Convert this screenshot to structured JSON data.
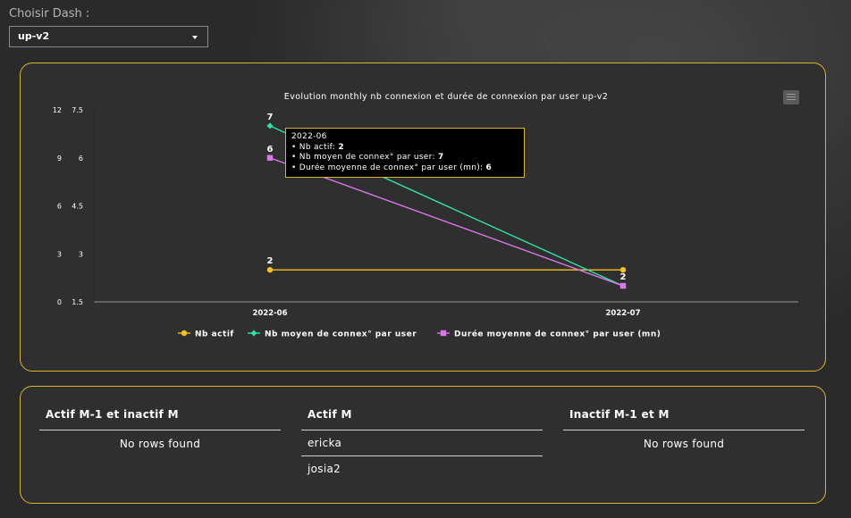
{
  "selector": {
    "label": "Choisir Dash :",
    "value": "up-v2",
    "icon": "chevron-down-icon"
  },
  "chart_menu_icon": "hamburger-menu-icon",
  "chart_data": {
    "type": "line",
    "title": "Evolution monthly nb connexion et durée de connexion par user up-v2",
    "categories": [
      "2022-06",
      "2022-07"
    ],
    "axes": [
      {
        "ticks": [
          "0",
          "3",
          "6",
          "9",
          "12"
        ],
        "range": [
          0,
          12
        ]
      },
      {
        "ticks": [
          "1.5",
          "3",
          "4.5",
          "6",
          "7.5"
        ],
        "range": [
          1.5,
          7.5
        ]
      }
    ],
    "series": [
      {
        "name": "Nb actif",
        "values": [
          2,
          2
        ],
        "labels": [
          "2",
          ""
        ],
        "color": "#f4c21d",
        "marker": "circle",
        "axis": 0
      },
      {
        "name": "Nb moyen de connex° par user",
        "values": [
          7,
          2
        ],
        "labels": [
          "7",
          "2"
        ],
        "color": "#2de3a7",
        "marker": "diamond",
        "axis": 1
      },
      {
        "name": "Durée moyenne de connex° par user (mn)",
        "values": [
          6,
          2
        ],
        "labels": [
          "6",
          ""
        ],
        "color": "#d976e8",
        "marker": "square",
        "axis": 1
      }
    ],
    "grid": false,
    "legend": "bottom",
    "tooltip": {
      "title": "2022-06",
      "items": [
        {
          "label": "Nb actif:",
          "value": "2"
        },
        {
          "label": "Nb moyen de connex° par user:",
          "value": "7"
        },
        {
          "label": "Durée moyenne de connex° par user (mn):",
          "value": "6"
        }
      ]
    }
  },
  "tables": [
    {
      "title": "Actif M-1 et inactif M",
      "rows": [],
      "empty": "No rows found"
    },
    {
      "title": "Actif M",
      "rows": [
        "ericka",
        "josia2"
      ],
      "empty": ""
    },
    {
      "title": "Inactif M-1 et M",
      "rows": [],
      "empty": "No rows found"
    }
  ]
}
